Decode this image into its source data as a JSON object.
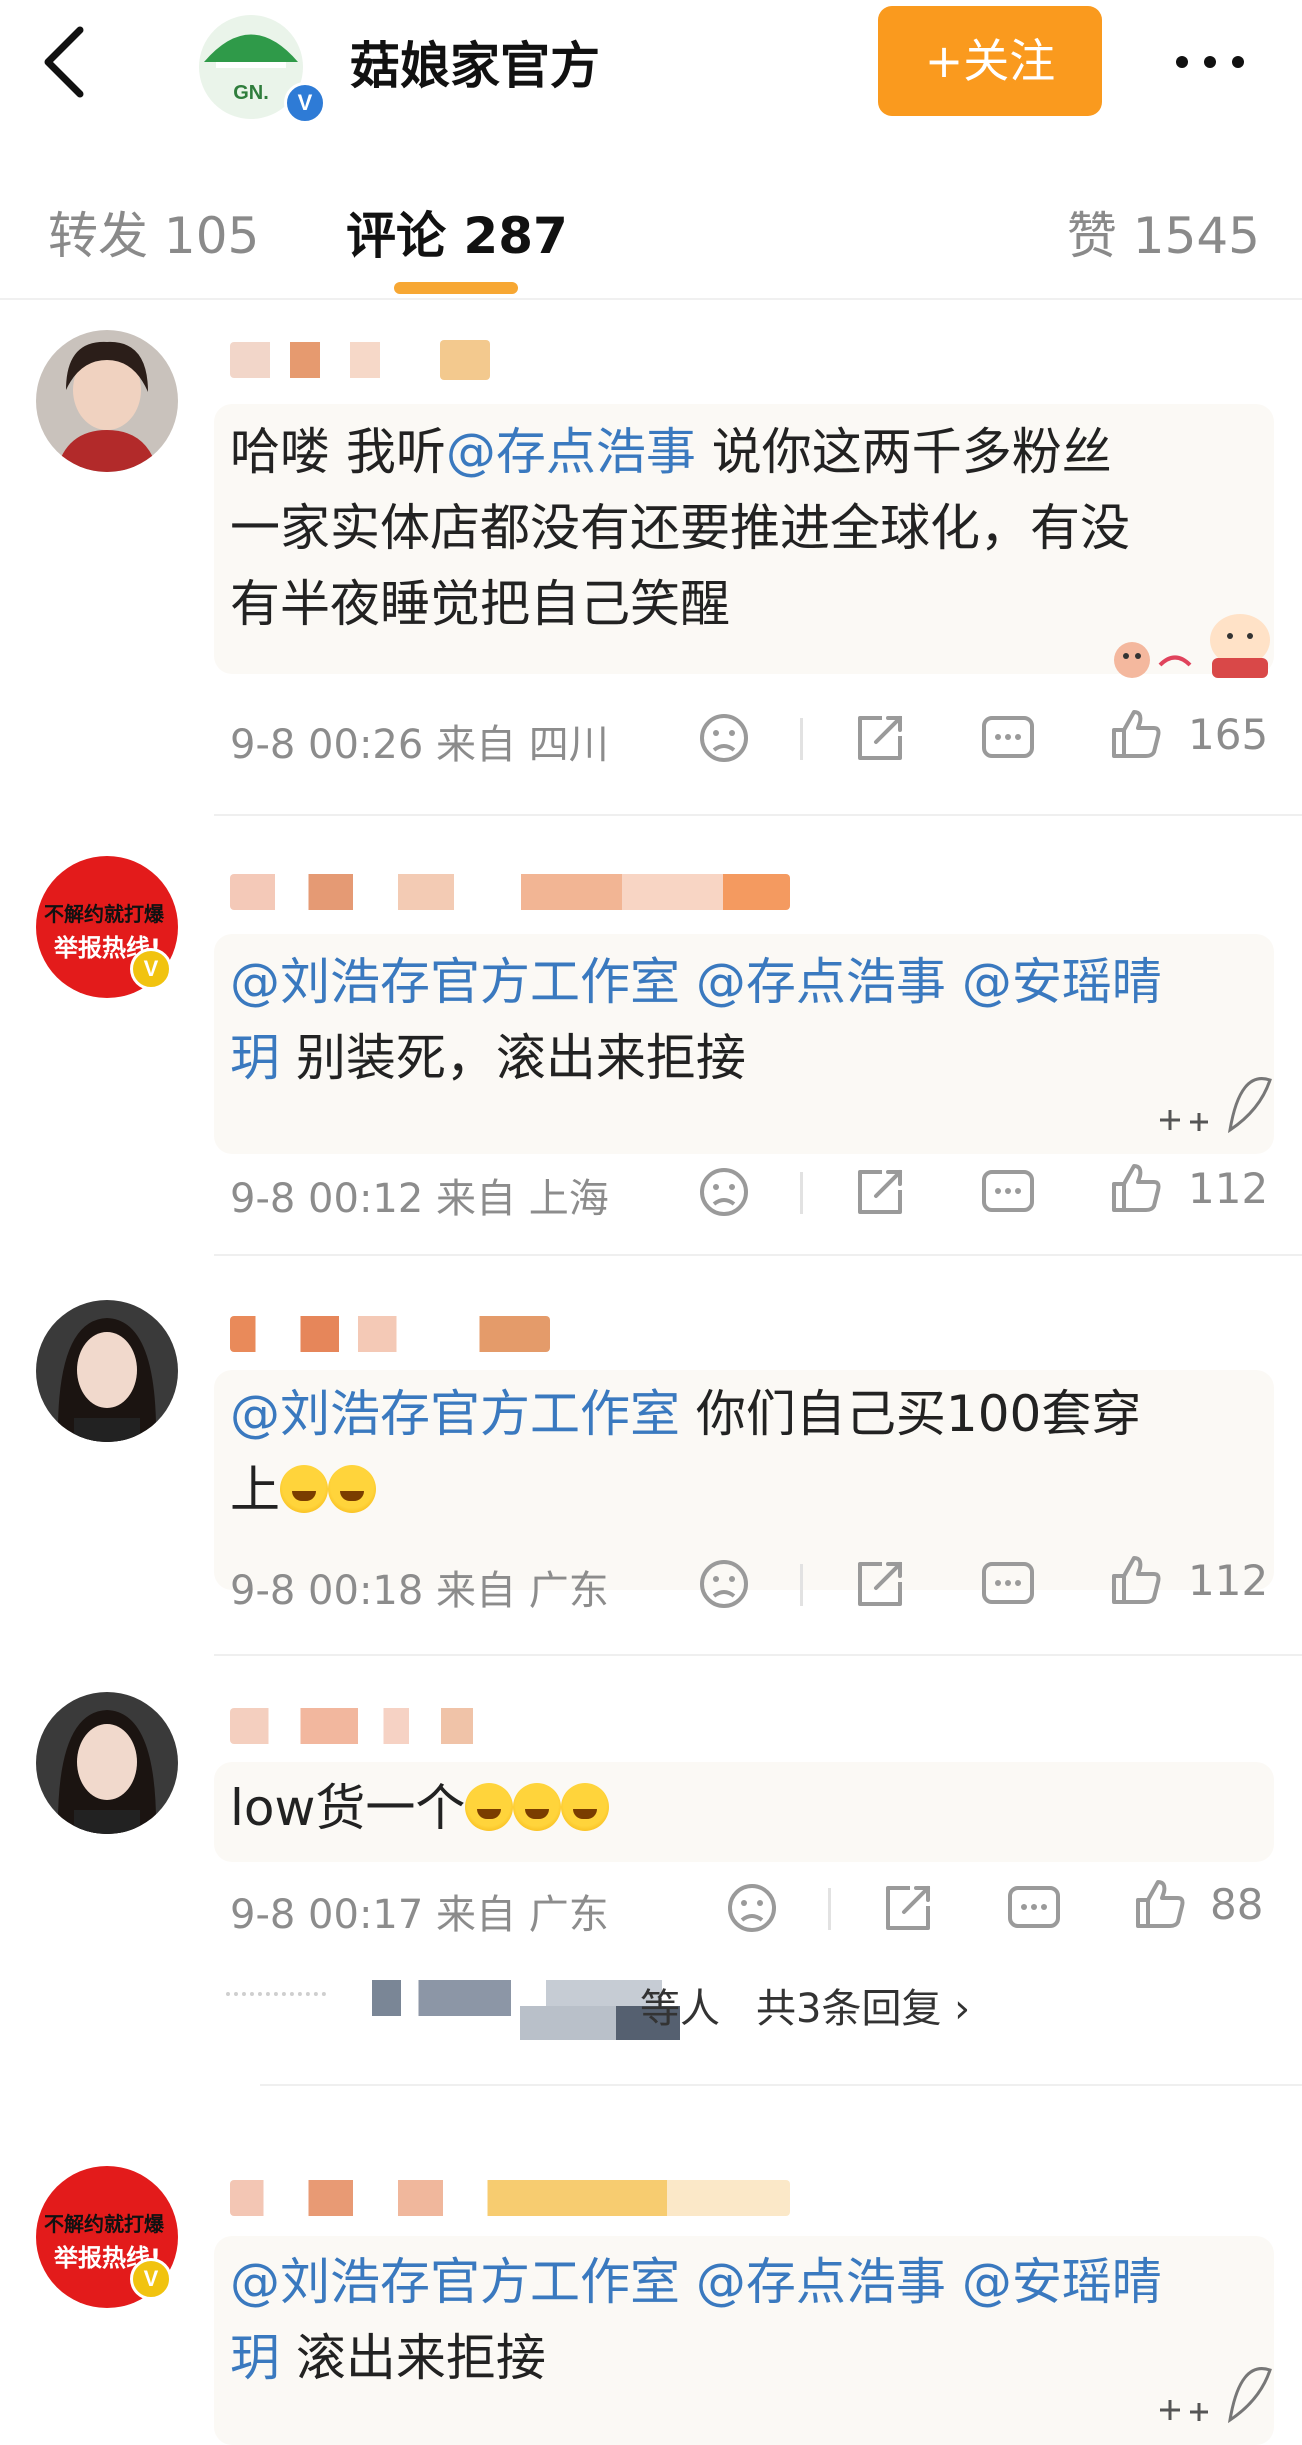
{
  "header": {
    "account_name": "菇娘家官方",
    "logo_text": "GN.",
    "verified_mark": "V",
    "follow_label": "+关注",
    "more_label": "•••"
  },
  "tabs": [
    {
      "label": "转发 105"
    },
    {
      "label": "评论 287"
    },
    {
      "label": "赞 1545"
    }
  ],
  "comments": [
    {
      "text_parts": [
        "哈喽 我听",
        "@存点浩事",
        " 说你这两千多粉丝"
      ],
      "line2": "一家实体店都没有还要推进全球化，有没",
      "line3": "有半夜睡觉把自己笑醒",
      "time": "9-8 00:26",
      "source": "来自 四川",
      "likes": "165"
    },
    {
      "line1_parts": [
        "@刘浩存官方工作室",
        " ",
        "@存点浩事",
        " ",
        "@安瑶晴"
      ],
      "line2_parts": [
        "玥",
        " 别装死，滚出来拒接"
      ],
      "avatar_text_1": "不解约就打爆",
      "avatar_text_2": "举报热线!",
      "time": "9-8 00:12",
      "source": "来自 上海",
      "likes": "112"
    },
    {
      "line1_parts": [
        "@刘浩存官方工作室",
        " 你们自己买100套穿"
      ],
      "line2": "上",
      "time": "9-8 00:18",
      "source": "来自 广东",
      "likes": "112"
    },
    {
      "line1": "low货一个",
      "time": "9-8 00:17",
      "source": "来自 广东",
      "likes": "88",
      "replies_suffix": "等人",
      "replies_label": "共3条回复",
      "replies_arrow": "›"
    },
    {
      "line1_parts": [
        "@刘浩存官方工作室",
        " ",
        "@存点浩事",
        " ",
        "@安瑶晴"
      ],
      "line2_parts": [
        "玥",
        " 滚出来拒接"
      ],
      "avatar_text_1": "不解约就打爆",
      "avatar_text_2": "举报热线!"
    }
  ],
  "colors": {
    "accent": "#fa9a1e",
    "mention": "#3a79bf",
    "underline": "#f7a733"
  },
  "icons": [
    "back-arrow-icon",
    "verified-badge-icon",
    "more-icon",
    "dislike-icon",
    "share-icon",
    "comment-icon",
    "like-icon",
    "laugh-cry-emoji-icon"
  ]
}
